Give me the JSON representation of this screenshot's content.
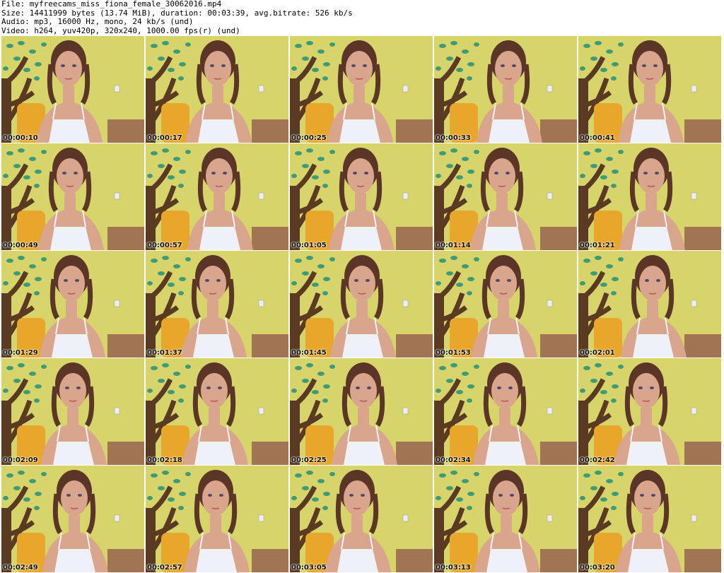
{
  "header": {
    "file": "File: myfreecams_miss_fiona_female_30062016.mp4",
    "size": "Size: 14411999 bytes (13.74 MiB), duration: 00:03:39, avg.bitrate: 526 kb/s",
    "audio": "Audio: mp3, 16000 Hz, mono, 24 kb/s (und)",
    "video": "Video: h264, yuv420p, 320x240, 1000.00 fps(r) (und)"
  },
  "thumbnails": [
    {
      "timestamp": "00:00:10"
    },
    {
      "timestamp": "00:00:17"
    },
    {
      "timestamp": "00:00:25"
    },
    {
      "timestamp": "00:00:33"
    },
    {
      "timestamp": "00:00:41"
    },
    {
      "timestamp": "00:00:49"
    },
    {
      "timestamp": "00:00:57"
    },
    {
      "timestamp": "00:01:05"
    },
    {
      "timestamp": "00:01:14"
    },
    {
      "timestamp": "00:01:21"
    },
    {
      "timestamp": "00:01:29"
    },
    {
      "timestamp": "00:01:37"
    },
    {
      "timestamp": "00:01:45"
    },
    {
      "timestamp": "00:01:53"
    },
    {
      "timestamp": "00:02:01"
    },
    {
      "timestamp": "00:02:09"
    },
    {
      "timestamp": "00:02:18"
    },
    {
      "timestamp": "00:02:25"
    },
    {
      "timestamp": "00:02:34"
    },
    {
      "timestamp": "00:02:42"
    },
    {
      "timestamp": "00:02:49"
    },
    {
      "timestamp": "00:02:57"
    },
    {
      "timestamp": "00:03:05"
    },
    {
      "timestamp": "00:03:13"
    },
    {
      "timestamp": "00:03:20"
    }
  ],
  "colors": {
    "wall": "#d6d46a",
    "tree": "#5a3a22",
    "leaves": "#3f9a78",
    "skin": "#d9a58c",
    "hair": "#5b3526",
    "top": "#eef2f8",
    "pillow": "#e8a62a"
  }
}
